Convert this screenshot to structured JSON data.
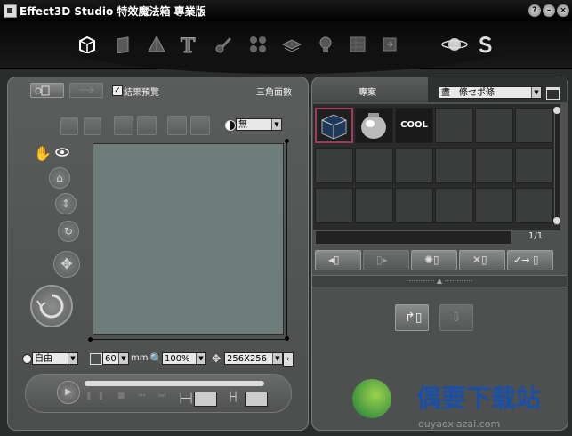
{
  "window": {
    "title": "Effect3D Studio 特效魔法箱 專業版",
    "help_label": "?",
    "minimize_label": "–",
    "close_label": "×"
  },
  "toolbar": {
    "icons": [
      "cube-icon",
      "box-icon",
      "pyramid-icon",
      "text-3d-icon",
      "paint-icon",
      "dots-icon",
      "layers-icon",
      "bulb-icon",
      "texture-icon",
      "export-icon",
      "planet-icon",
      "s-logo-icon"
    ]
  },
  "left": {
    "preview_checkbox_label": "結果預覽",
    "polygon_label": "三角面數",
    "shading_select": "無",
    "mode_select": "自由",
    "mm_value": "60",
    "mm_unit": "mm",
    "zoom_value": "100%",
    "size_value": "256X256"
  },
  "right": {
    "tab_label": "專案",
    "category_select": "盡　條セポ條",
    "page_indicator": "1/1",
    "thumbnails": [
      {
        "name": "metal-cube-thumbnail"
      },
      {
        "name": "silver-vase-thumbnail"
      },
      {
        "name": "cool-text-thumbnail",
        "text": "COOL"
      }
    ],
    "checkbox_arrow_label": "✓→"
  },
  "watermark": {
    "brand": "偶要下载站",
    "url": "ouyaoxiazai.com"
  },
  "colors": {
    "window_bg": "#2b2d2c",
    "panel_bg": "#545655",
    "canvas_bg": "#6e7c7a",
    "watermark_blue": "#1a4fa8"
  }
}
